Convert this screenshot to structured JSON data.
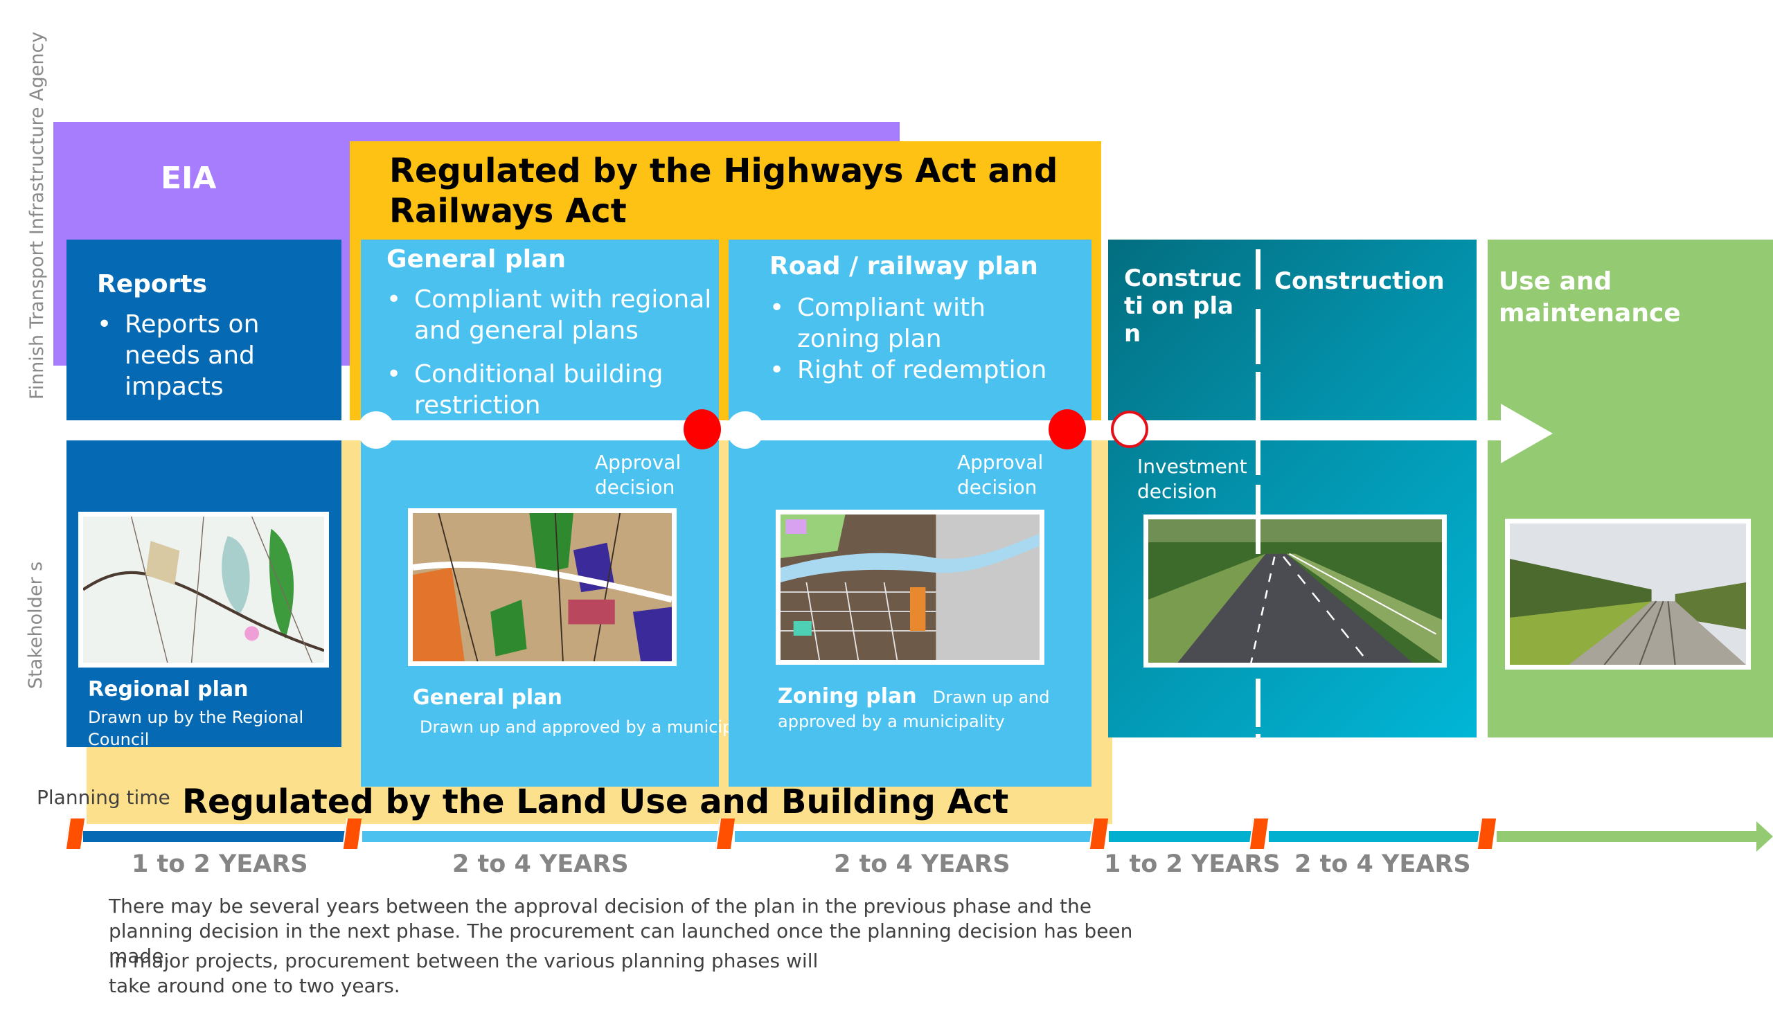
{
  "side_labels": {
    "agency": "Finnish Transport Infrastructure Agency",
    "stakeholders": "Stakeholder s"
  },
  "eia": {
    "title": "EIA"
  },
  "highways_act": {
    "title": "Regulated by the Highways Act and Railways Act"
  },
  "land_use_act": {
    "title": "Regulated by the Land Use and Building Act"
  },
  "phases": {
    "reports": {
      "title": "Reports",
      "bullets": [
        "Reports on needs and impacts"
      ],
      "caption_title": "Regional plan",
      "caption_sub": "Drawn up by the Regional Council",
      "image": "regional-plan-map"
    },
    "general_plan": {
      "title": "General plan",
      "bullets": [
        "Compliant with regional and general plans",
        "Conditional building restriction"
      ],
      "milestone": "Approval decision",
      "caption_title": "General plan",
      "caption_sub": "Drawn up and approved by a municipality",
      "image": "general-plan-map"
    },
    "road_railway_plan": {
      "title": "Road / railway plan",
      "bullets": [
        "Compliant with zoning plan",
        "Right of redemption"
      ],
      "milestone": "Approval decision",
      "caption_title": "Zoning plan",
      "caption_sub": "Drawn up and approved by a municipality",
      "image": "zoning-plan-map"
    },
    "construction_plan": {
      "title": "Constructi on plan",
      "milestone": "Investment decision",
      "image": "road-photo"
    },
    "construction": {
      "title": "Construction"
    },
    "use_maintenance": {
      "title": "Use and maintenance",
      "image": "railway-photo"
    }
  },
  "timeline": {
    "label": "Planning time",
    "segments": [
      {
        "label": "1 to 2 YEARS",
        "color": "#0569b4"
      },
      {
        "label": "2 to 4 YEARS",
        "color": "#4bc1ef"
      },
      {
        "label": "2 to 4 YEARS",
        "color": "#4bc1ef"
      },
      {
        "label": "1 to 2 YEARS",
        "color": "#01b0cf"
      },
      {
        "label": "2 to 4 YEARS",
        "color": "#01b0cf"
      },
      {
        "label": "",
        "color": "#94ca72"
      }
    ]
  },
  "milestones": [
    {
      "type": "start",
      "color": "#ffffff"
    },
    {
      "type": "approval",
      "color": "#ff0000"
    },
    {
      "type": "start",
      "color": "#ffffff"
    },
    {
      "type": "approval",
      "color": "#ff0000"
    },
    {
      "type": "investment",
      "color": "#ffffff",
      "border": "#e3101a"
    }
  ],
  "notes": [
    "There may be several years between the approval decision of the plan in the previous phase and the planning decision in the next phase. The procurement can launched once the planning decision has been made.",
    "In major projects, procurement between the various planning phases will take around one to two years."
  ],
  "colors": {
    "eia": "#a77cfd",
    "highways": "#fdc214",
    "land_use": "#fde08b",
    "dark_blue": "#0569b4",
    "light_blue": "#4bc1ef",
    "teal": "#0391ab",
    "green": "#94ca72",
    "tick": "#fe5000"
  }
}
